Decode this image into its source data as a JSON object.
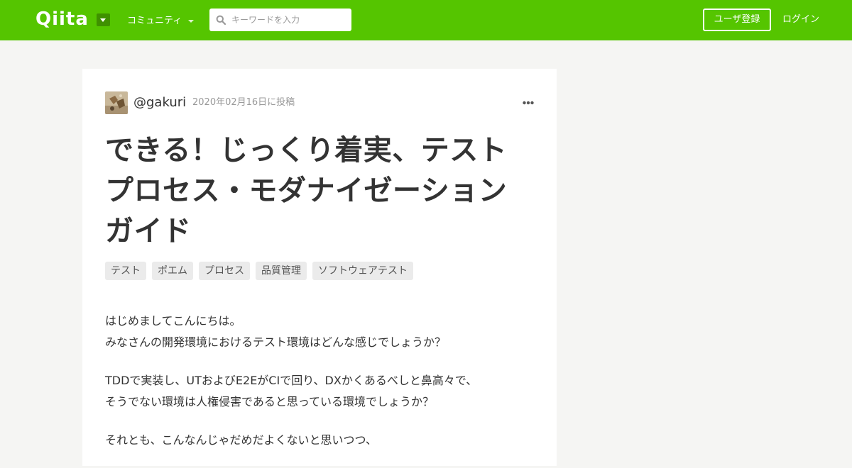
{
  "header": {
    "logo_text": "Qiita",
    "community_label": "コミュニティ",
    "search": {
      "placeholder": "キーワードを入力",
      "value": ""
    },
    "signup_label": "ユーザ登録",
    "login_label": "ログイン",
    "colors": {
      "brand": "#55c500",
      "brand_dark": "#3f9100"
    }
  },
  "article": {
    "author": "@gakuri",
    "posted_at": "2020年02月16日に投稿",
    "title_lines": [
      "できる！じっくり着実、テスト",
      "プロセス・モダナイゼーション",
      "ガイド"
    ],
    "tags": [
      "テスト",
      "ポエム",
      "プロセス",
      "品質管理",
      "ソフトウェアテスト"
    ],
    "paragraphs": [
      {
        "lines": [
          "はじめましてこんにちは。",
          "みなさんの開発環境におけるテスト環境はどんな感じでしょうか？"
        ]
      },
      {
        "lines": [
          "TDDで実装し、UTおよびE2EがCIで回り、DXかくあるべしと鼻高々で、",
          "そうでない環境は人権侵害であると思っている環境でしょうか？"
        ]
      },
      {
        "lines": [
          "それとも、こんなんじゃだめだよくないと思いつつ、"
        ]
      }
    ]
  }
}
